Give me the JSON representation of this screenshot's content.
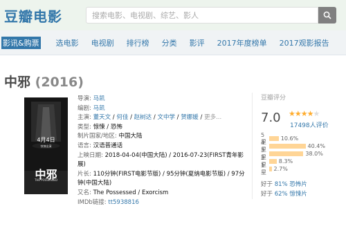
{
  "header": {
    "logo": "豆瓣电影",
    "search_placeholder": "搜索电影、电视剧、综艺、影人"
  },
  "nav": [
    "影讯&购票",
    "选电影",
    "电视剧",
    "排行榜",
    "分类",
    "影评",
    "2017年度榜单",
    "2017观影报告"
  ],
  "movie": {
    "title": "中邪",
    "year": "(2016)",
    "poster": {
      "date": "4月4日",
      "sub": "惊悚出演",
      "name": "中邪",
      "en": "THE POSSESSED"
    },
    "info": {
      "director_label": "导演:",
      "director": "马凯",
      "writer_label": "编剧:",
      "writer": "马凯",
      "cast_label": "主演:",
      "cast": [
        "董天文",
        "何佳",
        "赵树达",
        "文中学",
        "贺娜媛",
        "更多..."
      ],
      "genre_label": "类型:",
      "genre": "惊悚 / 恐怖",
      "country_label": "制片国家/地区:",
      "country": "中国大陆",
      "lang_label": "语言:",
      "lang": "汉语普通话",
      "release_label": "上映日期:",
      "release": "2018-04-04(中国大陆) / 2016-07-23(FIRST青年影展)",
      "runtime_label": "片长:",
      "runtime": "110分钟(FIRST电影节版) / 95分钟(夏纳电影节版) / 97分钟(中国大陆)",
      "aka_label": "又名:",
      "aka": "The Possessed / Exorcism",
      "imdb_label": "IMDb链接:",
      "imdb": "tt5938816"
    }
  },
  "rating": {
    "label": "豆瓣评分",
    "score": "7.0",
    "stars_value": 3.5,
    "votes": "17498人评价",
    "distribution": [
      {
        "label": "5星",
        "pct": "10.6%",
        "value": 10.6
      },
      {
        "label": "4星",
        "pct": "40.4%",
        "value": 40.4
      },
      {
        "label": "3星",
        "pct": "38.0%",
        "value": 38.0
      },
      {
        "label": "2星",
        "pct": "8.3%",
        "value": 8.3
      },
      {
        "label": "1星",
        "pct": "2.7%",
        "value": 2.7
      }
    ],
    "better1_prefix": "好于",
    "better1_pct": "81%",
    "better1_genre": "恐怖片",
    "better2_prefix": "好于",
    "better2_pct": "62%",
    "better2_genre": "惊悚片"
  },
  "colors": {
    "brand": "#3377aa",
    "star": "#ffac2d",
    "bar": "#ffd596"
  }
}
